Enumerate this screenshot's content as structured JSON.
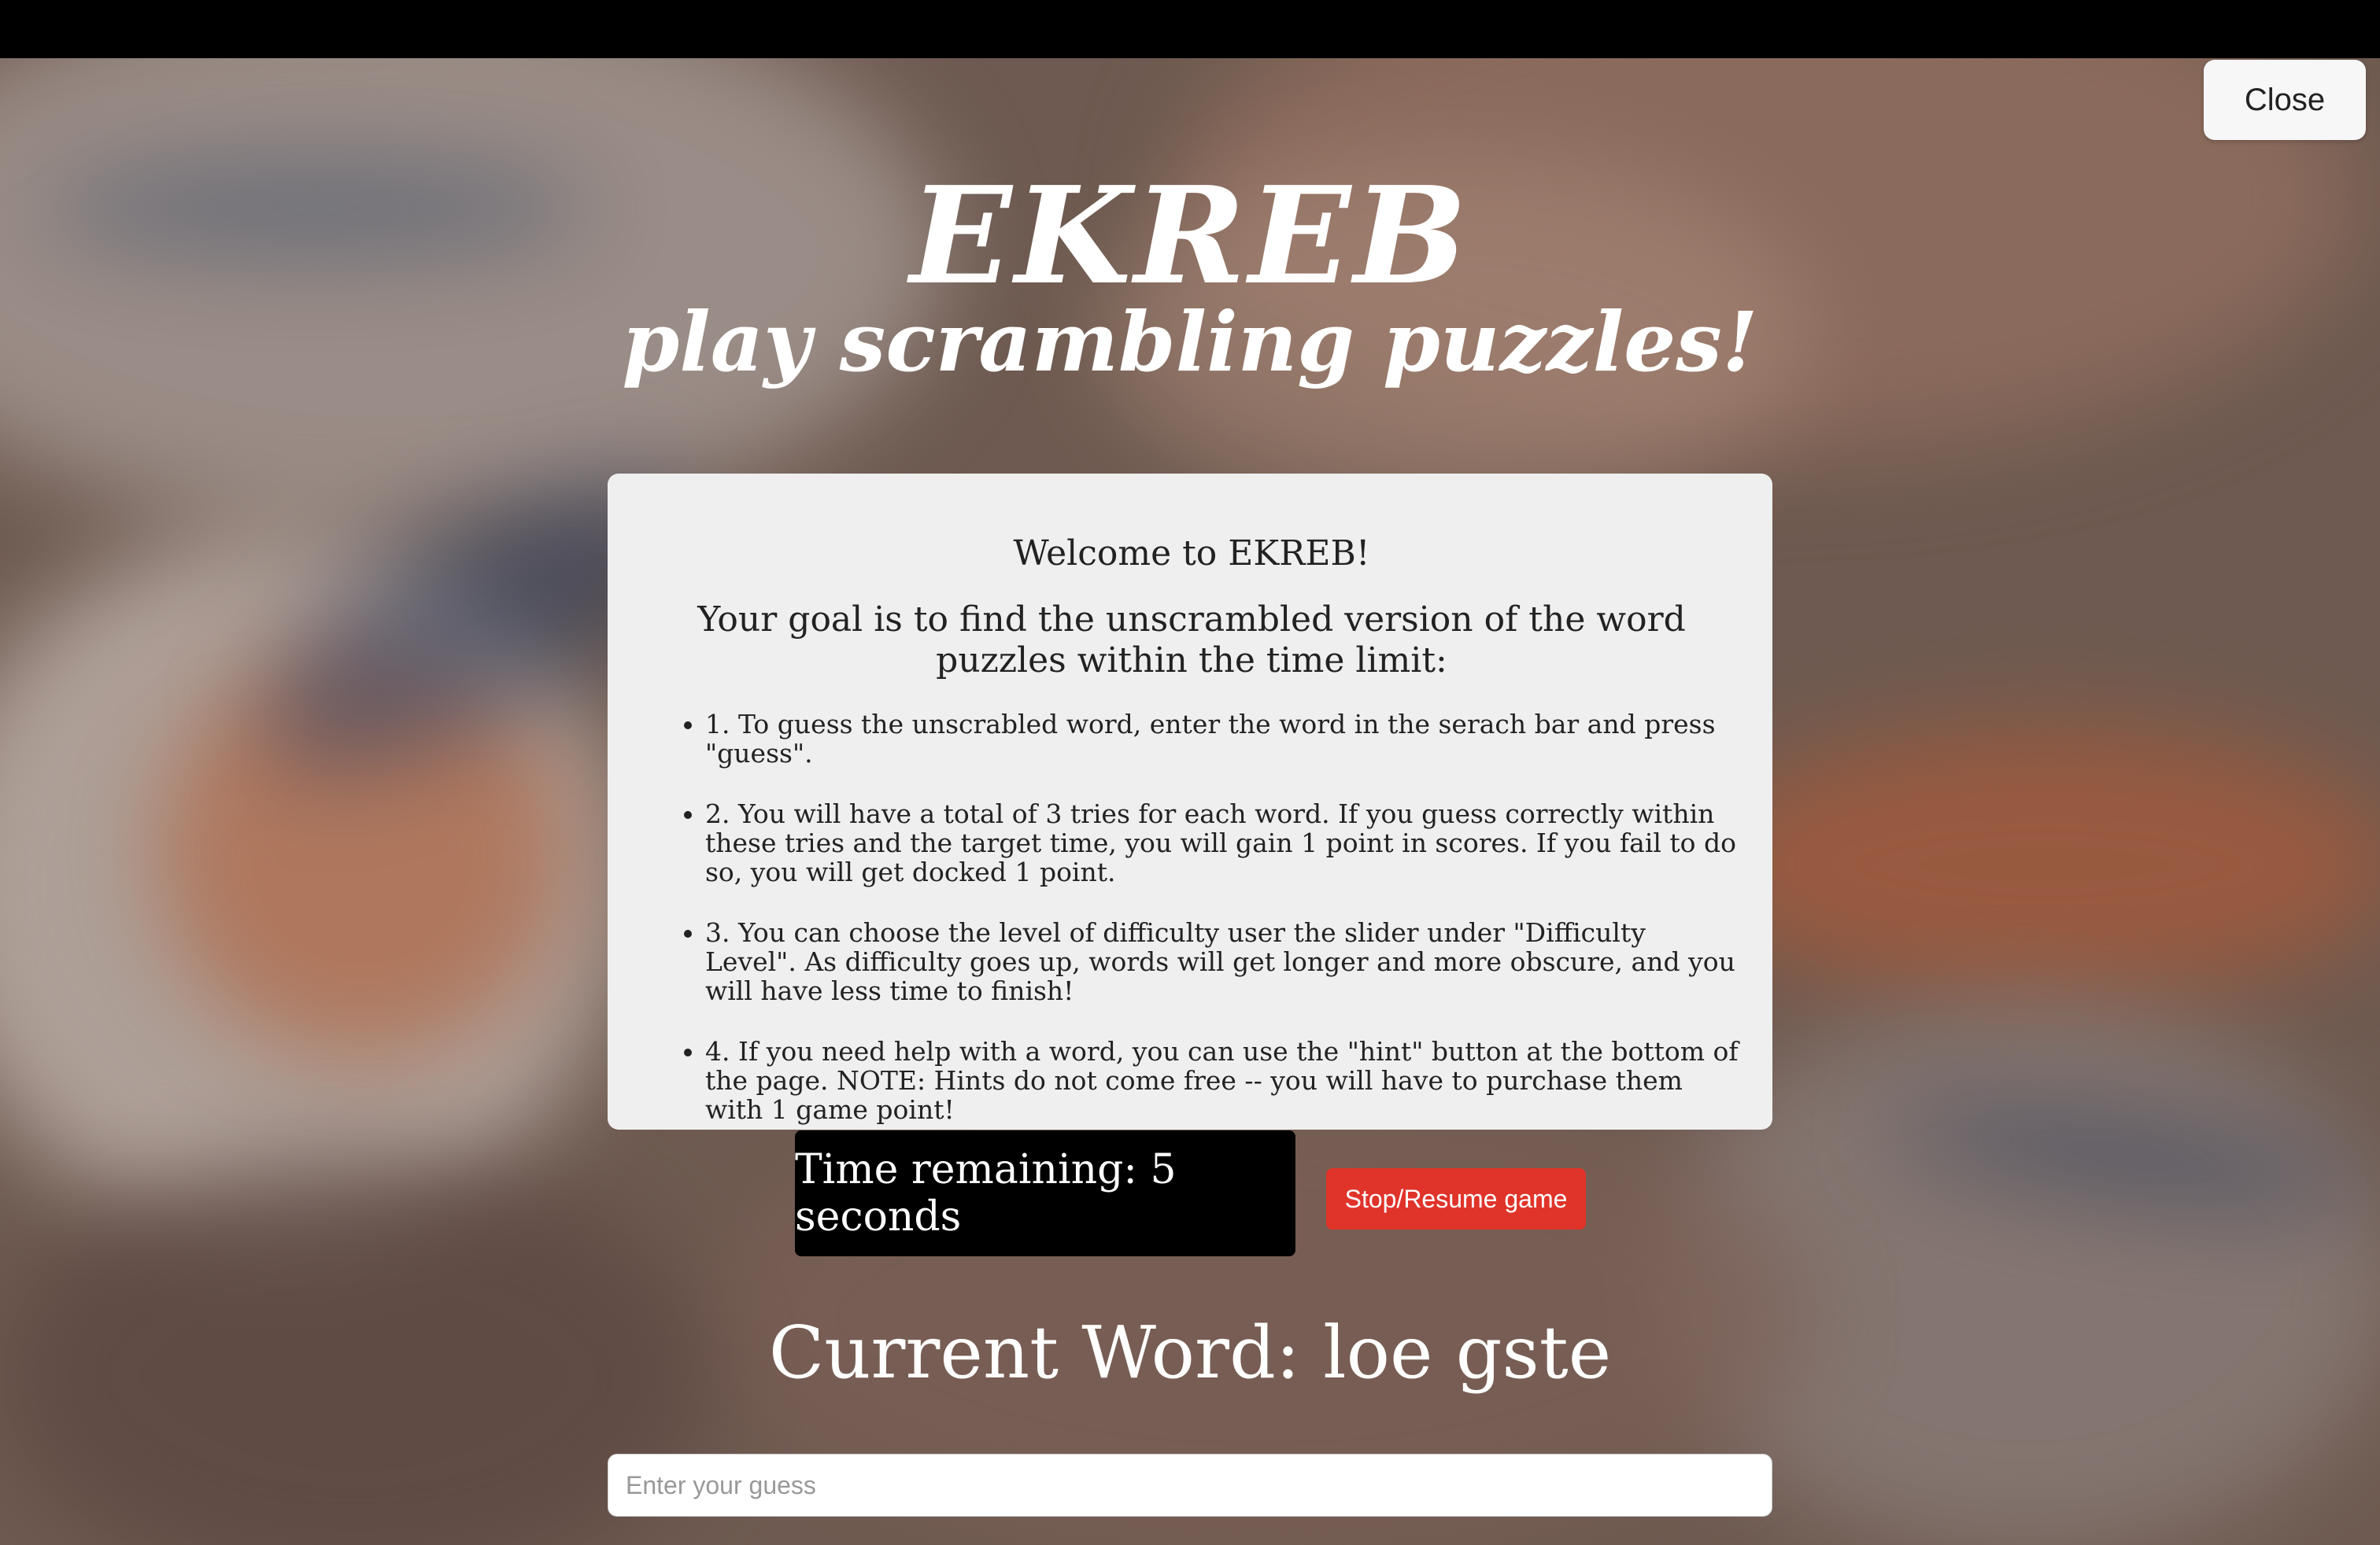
{
  "window": {
    "close_label": "Close"
  },
  "header": {
    "title": "EKREB",
    "subtitle": "play scrambling puzzles!"
  },
  "instructions": {
    "welcome": "Welcome to EKREB!",
    "goal": "Your goal is to find the unscrambled version of the word puzzles within the time limit:",
    "rules": [
      "1. To guess the unscrabled word, enter the word in the serach bar and press \"guess\".",
      "2. You will have a total of 3 tries for each word. If you guess correctly within these tries and the target time, you will gain 1 point in scores. If you fail to do so, you will get docked 1 point.",
      "3. You can choose the level of difficulty user the slider under \"Difficulty Level\". As difficulty goes up, words will get longer and more obscure, and you will have less time to finish!",
      "4. If you need help with a word, you can use the \"hint\" button at the bottom of the page. NOTE: Hints do not come free -- you will have to purchase them with 1 game point!"
    ]
  },
  "game": {
    "timer_text": "Time remaining: 5 seconds",
    "stop_resume_label": "Stop/Resume game",
    "current_word_label": "Current Word: ",
    "current_word": "loe gste",
    "guess_placeholder": "Enter your guess",
    "guess_value": ""
  },
  "colors": {
    "stop_button": "#e0342a",
    "timer_bg": "#000000",
    "card_bg": "#efefef"
  }
}
